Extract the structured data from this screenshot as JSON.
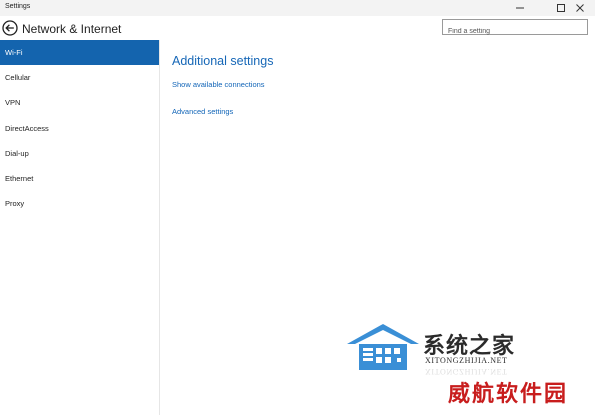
{
  "window": {
    "title": "Settings",
    "minimize_icon": "minimize-icon",
    "maximize_icon": "maximize-icon",
    "close_icon": "close-icon"
  },
  "header": {
    "back_icon": "back-arrow-icon",
    "title": "Network & Internet",
    "search_placeholder": "Find a setting"
  },
  "sidebar": {
    "items": [
      {
        "label": "Wi-Fi",
        "active": true
      },
      {
        "label": "Cellular"
      },
      {
        "label": "VPN"
      },
      {
        "label": "DirectAccess"
      },
      {
        "label": "Dial-up"
      },
      {
        "label": "Ethernet"
      },
      {
        "label": "Proxy"
      }
    ]
  },
  "main": {
    "section_title": "Additional settings",
    "links": [
      "Show available connections",
      "Advanced settings"
    ]
  },
  "watermark": {
    "logo_icon": "house-logo-icon",
    "cn_text": "系统之家",
    "en_text": "XITONGZHIJIA.NET",
    "secondary_text": "威航软件园"
  },
  "colors": {
    "accent": "#1464ae",
    "link": "#1366b8",
    "watermark_red": "#c81d1d"
  }
}
